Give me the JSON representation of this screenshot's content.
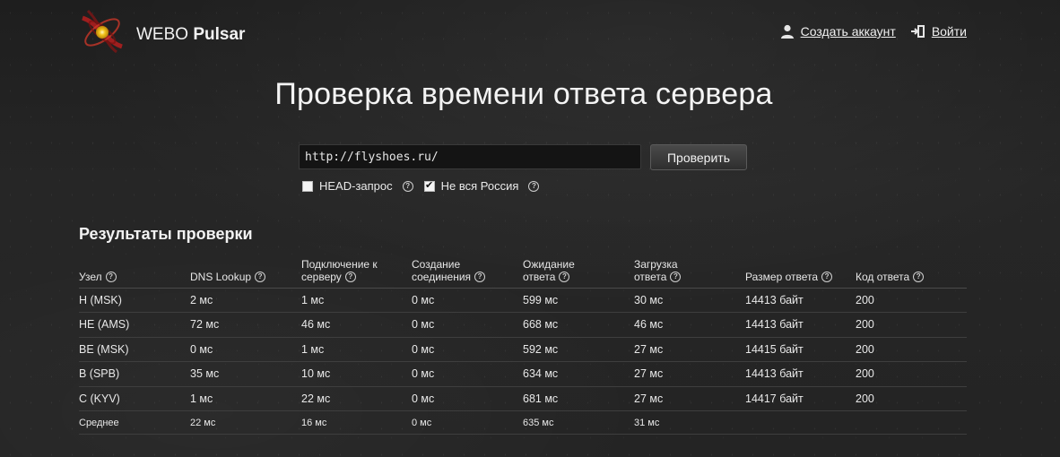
{
  "header": {
    "logo_text_regular": "WEBO",
    "logo_text_bold": "Pulsar",
    "create_account": "Создать аккаунт",
    "login": "Войти"
  },
  "main": {
    "title": "Проверка времени ответа сервера",
    "url_value": "http://flyshoes.ru/",
    "check_button": "Проверить",
    "options": {
      "head_request": {
        "label": "HEAD-запрос",
        "checked": false
      },
      "not_all_russia": {
        "label": "Не вся Россия",
        "checked": true
      }
    }
  },
  "results": {
    "title": "Результаты проверки",
    "headers": [
      {
        "line1": "Узел",
        "line2": ""
      },
      {
        "line1": "DNS Lookup",
        "line2": ""
      },
      {
        "line1": "Подключение к",
        "line2": "серверу"
      },
      {
        "line1": "Создание",
        "line2": "соединения"
      },
      {
        "line1": "Ожидание",
        "line2": "ответа"
      },
      {
        "line1": "Загрузка",
        "line2": "ответа"
      },
      {
        "line1": "Размер ответа",
        "line2": ""
      },
      {
        "line1": "Код ответа",
        "line2": ""
      }
    ],
    "rows": [
      [
        "H (MSK)",
        "2 мс",
        "1 мс",
        "0 мс",
        "599 мс",
        "30 мс",
        "14413 байт",
        "200"
      ],
      [
        "HE (AMS)",
        "72 мс",
        "46 мс",
        "0 мс",
        "668 мс",
        "46 мс",
        "14413 байт",
        "200"
      ],
      [
        "BE (MSK)",
        "0 мс",
        "1 мс",
        "0 мс",
        "592 мс",
        "27 мс",
        "14415 байт",
        "200"
      ],
      [
        "B (SPB)",
        "35 мс",
        "10 мс",
        "0 мс",
        "634 мс",
        "27 мс",
        "14413 байт",
        "200"
      ],
      [
        "C (KYV)",
        "1 мс",
        "22 мс",
        "0 мс",
        "681 мс",
        "27 мс",
        "14417 байт",
        "200"
      ]
    ],
    "average": [
      "Среднее",
      "22 мс",
      "16 мс",
      "0 мс",
      "635 мс",
      "31 мс",
      "",
      ""
    ]
  },
  "colors": {
    "background": "#232323",
    "text": "#e6e6e6",
    "logo_accent": "#d4382a"
  }
}
